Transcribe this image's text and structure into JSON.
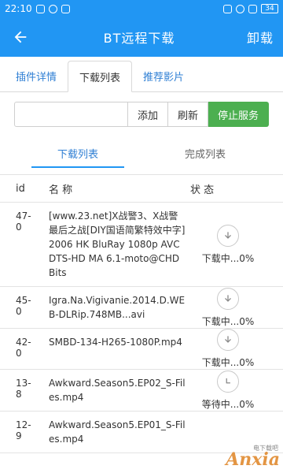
{
  "status_bar": {
    "time": "22:10",
    "battery": "34"
  },
  "app_bar": {
    "back_icon": "arrow-left-icon",
    "title": "BT远程下载",
    "action_label": "卸载"
  },
  "tabs": [
    {
      "label": "插件详情",
      "active": false
    },
    {
      "label": "下载列表",
      "active": true
    },
    {
      "label": "推荐影片",
      "active": false
    }
  ],
  "actions": {
    "input_value": "",
    "input_placeholder": "",
    "add_label": "添加",
    "refresh_label": "刷新",
    "stop_label": "停止服务"
  },
  "subtabs": [
    {
      "label": "下载列表",
      "active": true
    },
    {
      "label": "完成列表",
      "active": false
    }
  ],
  "table": {
    "headers": {
      "id": "id",
      "name": "名 称",
      "status": "状 态"
    },
    "rows": [
      {
        "id": "47-0",
        "name": "[www.23.net]X战警3、X战警最后之战[DIY国语简繁特效中字]2006 HK BluRay 1080p AVC DTS-HD MA 6.1-moto@CHDBits",
        "status": "下载中...0%",
        "icon": "download-icon"
      },
      {
        "id": "45-0",
        "name": "Igra.Na.Vigivanie.2014.D.WEB-DLRip.748MB...avi",
        "status": "下载中...0%",
        "icon": "download-icon"
      },
      {
        "id": "42-0",
        "name": "SMBD-134-H265-1080P.mp4",
        "status": "下载中...0%",
        "icon": "download-icon"
      },
      {
        "id": "13-8",
        "name": "Awkward.Season5.EP02_S-Files.mp4",
        "status": "等待中...0%",
        "icon": "clock-icon"
      },
      {
        "id": "12-9",
        "name": "Awkward.Season5.EP01_S-Files.mp4",
        "status": "",
        "icon": ""
      }
    ]
  },
  "watermark": {
    "text": "Anxia",
    "sub": "电下载吧"
  },
  "colors": {
    "primary": "#2196F3",
    "accent_green": "#4CAF50",
    "link_blue": "#2f7fd4"
  }
}
